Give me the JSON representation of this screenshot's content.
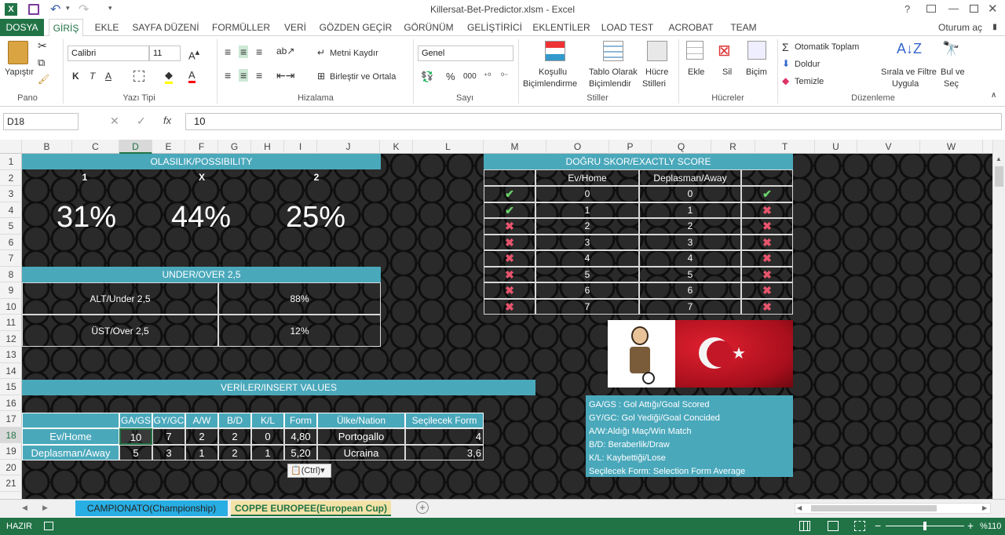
{
  "window": {
    "title": "Killersat-Bet-Predictor.xlsm - Excel",
    "help": "?"
  },
  "menu": {
    "file": "DOSYA",
    "tabs": [
      "GİRİŞ",
      "EKLE",
      "SAYFA DÜZENİ",
      "FORMÜLLER",
      "VERİ",
      "GÖZDEN GEÇİR",
      "GÖRÜNÜM",
      "GELİŞTİRİCİ",
      "EKLENTİLER",
      "LOAD TEST",
      "ACROBAT",
      "TEAM"
    ],
    "signin": "Oturum aç"
  },
  "ribbon": {
    "paste": "Yapıştır",
    "pano": "Pano",
    "font_name": "Calibri",
    "font_size": "11",
    "yazi_tipi": "Yazı Tipi",
    "bold": "K",
    "italic": "T",
    "underline": "A",
    "wrap": "Metni Kaydır",
    "merge": "Birleştir ve Ortala",
    "hizalama": "Hizalama",
    "number_format": "Genel",
    "sayi": "Sayı",
    "percent": "%",
    "thousands": "000",
    "cond1": "Koşullu",
    "cond2": "Biçimlendirme",
    "table1": "Tablo Olarak",
    "table2": "Biçimlendir",
    "cell1": "Hücre",
    "cell2": "Stilleri",
    "stiller": "Stiller",
    "insert": "Ekle",
    "delete": "Sil",
    "format": "Biçim",
    "hucreler": "Hücreler",
    "autosum": "Otomatik Toplam",
    "fill": "Doldur",
    "clear": "Temizle",
    "sort1": "Sırala ve Filtre",
    "sort2": "Uygula",
    "find1": "Bul ve",
    "find2": "Seç",
    "duzenleme": "Düzenleme"
  },
  "formula": {
    "namebox": "D18",
    "value": "10",
    "fx": "fx"
  },
  "columns": [
    "B",
    "C",
    "D",
    "E",
    "F",
    "G",
    "H",
    "I",
    "J",
    "K",
    "L",
    "M",
    "O",
    "P",
    "Q",
    "R",
    "T",
    "U",
    "V",
    "W",
    "X"
  ],
  "rows": [
    "1",
    "2",
    "3",
    "4",
    "5",
    "6",
    "7",
    "8",
    "9",
    "10",
    "11",
    "12",
    "13",
    "14",
    "15",
    "16",
    "17",
    "18",
    "19",
    "20",
    "21"
  ],
  "possibility": {
    "title": "OLASILIK/POSSIBILITY",
    "labels": [
      "1",
      "X",
      "2"
    ],
    "values": [
      "31%",
      "44%",
      "25%"
    ]
  },
  "underover": {
    "title": "UNDER/OVER 2,5",
    "rows": [
      {
        "label": "ALT/Under 2,5",
        "value": "88%"
      },
      {
        "label": "ÜST/Over 2,5",
        "value": "12%"
      }
    ]
  },
  "exact": {
    "title": "DOĞRU SKOR/EXACTLY SCORE",
    "home_hdr": "Ev/Home",
    "away_hdr": "Deplasman/Away",
    "rows": [
      {
        "left": "✔",
        "home": "0",
        "away": "0",
        "right": "✔",
        "lc": "ok",
        "rc": "ok"
      },
      {
        "left": "✔",
        "home": "1",
        "away": "1",
        "right": "✖",
        "lc": "ok",
        "rc": "no"
      },
      {
        "left": "✖",
        "home": "2",
        "away": "2",
        "right": "✖",
        "lc": "no",
        "rc": "no"
      },
      {
        "left": "✖",
        "home": "3",
        "away": "3",
        "right": "✖",
        "lc": "no",
        "rc": "no"
      },
      {
        "left": "✖",
        "home": "4",
        "away": "4",
        "right": "✖",
        "lc": "no",
        "rc": "no"
      },
      {
        "left": "✖",
        "home": "5",
        "away": "5",
        "right": "✖",
        "lc": "no",
        "rc": "no"
      },
      {
        "left": "✖",
        "home": "6",
        "away": "6",
        "right": "✖",
        "lc": "no",
        "rc": "no"
      },
      {
        "left": "✖",
        "home": "7",
        "away": "7",
        "right": "✖",
        "lc": "no",
        "rc": "no"
      }
    ]
  },
  "insert": {
    "title": "VERİLER/INSERT VALUES",
    "headers": [
      "GA/GS",
      "GY/GC",
      "A/W",
      "B/D",
      "K/L",
      "Form",
      "Ülke/Nation",
      "Seçilecek Form"
    ],
    "rows": [
      {
        "label": "Ev/Home",
        "cells": [
          "10",
          "7",
          "2",
          "2",
          "0",
          "4,80",
          "Portogallo",
          "4"
        ]
      },
      {
        "label": "Deplasman/Away",
        "cells": [
          "5",
          "3",
          "1",
          "2",
          "1",
          "5,20",
          "Ucraina",
          "3,6"
        ]
      }
    ],
    "paste_hint": "(Ctrl)"
  },
  "legend": [
    "GA/GS : Gol Attığı/Goal Scored",
    "GY/GC: Gol Yediği/Goal Concided",
    "A/W:Aldığı Maç/Win Match",
    "B/D: Beraberlik/Draw",
    "K/L: Kaybettiği/Lose",
    "Seçilecek Form: Selection Form Average"
  ],
  "sheets": [
    "CAMPIONATO(Championship)",
    "COPPE EUROPEE(European Cup)"
  ],
  "status": {
    "ready": "HAZIR",
    "zoom": "%110"
  },
  "colors": {
    "teal": "#4aa8bb",
    "excel_green": "#217346",
    "ok": "#6ad36a",
    "no": "#e8556d"
  }
}
